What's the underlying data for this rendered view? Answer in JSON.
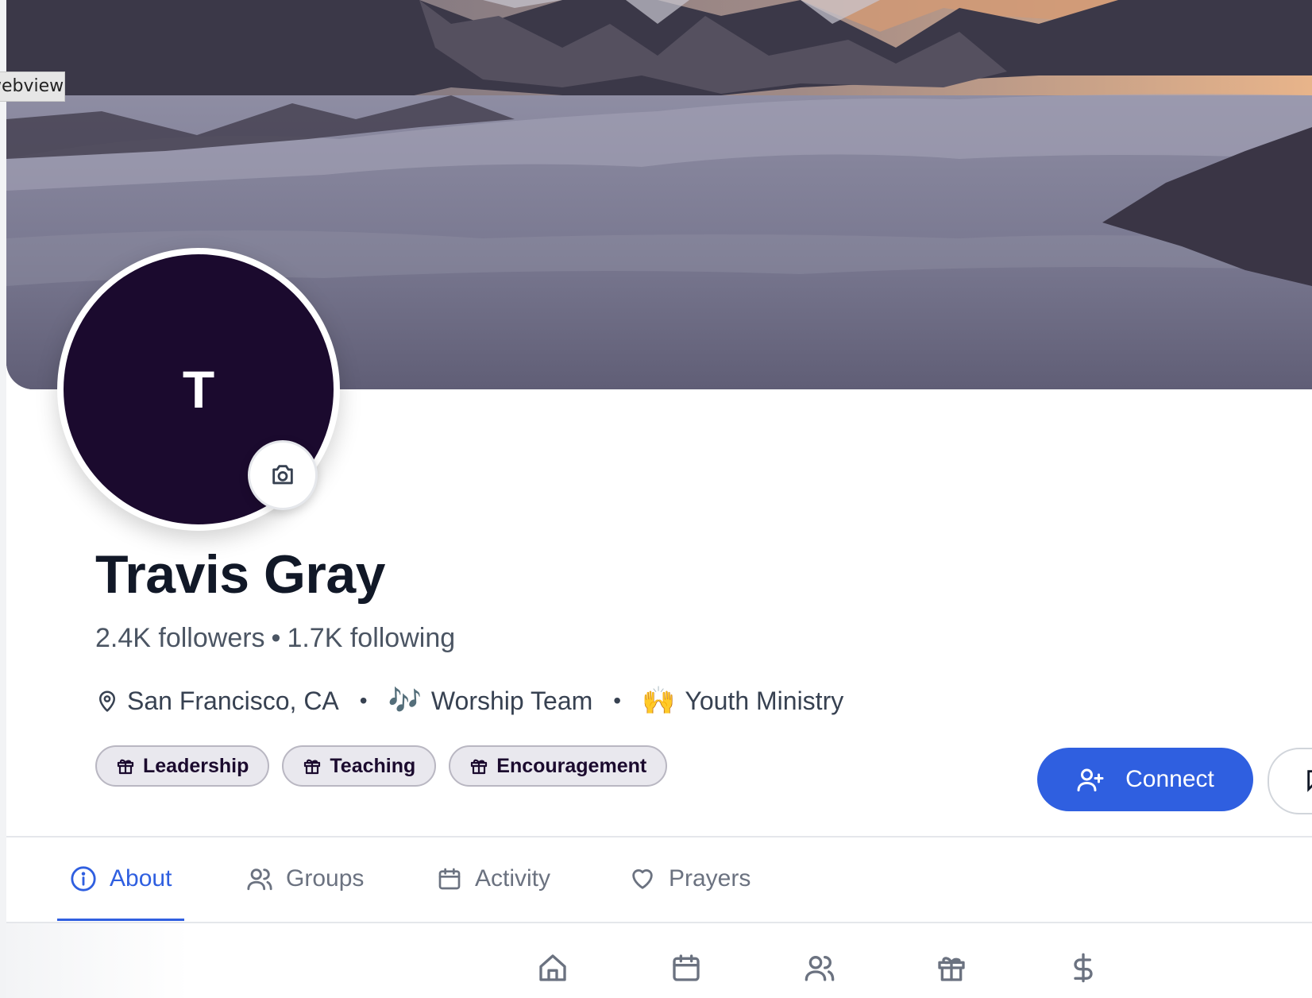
{
  "window": {
    "webview_label": "webview"
  },
  "profile": {
    "initial": "T",
    "name": "Travis Gray",
    "followers": "2.4K followers",
    "following": "1.7K following",
    "separator": "•",
    "location": "San Francisco, CA",
    "ministries": [
      {
        "emoji": "🎶",
        "label": "Worship Team"
      },
      {
        "emoji": "🙌",
        "label": "Youth Ministry"
      }
    ],
    "gifts": [
      "Leadership",
      "Teaching",
      "Encouragement"
    ]
  },
  "actions": {
    "connect_label": "Connect"
  },
  "tabs": [
    {
      "label": "About",
      "icon": "info-icon",
      "active": true
    },
    {
      "label": "Groups",
      "icon": "users-icon",
      "active": false
    },
    {
      "label": "Activity",
      "icon": "calendar-icon",
      "active": false
    },
    {
      "label": "Prayers",
      "icon": "heart-icon",
      "active": false
    }
  ],
  "bottom_nav": [
    "home-icon",
    "calendar-icon",
    "users-icon",
    "gift-icon",
    "dollar-icon"
  ],
  "colors": {
    "accent": "#2f5fe0",
    "avatar_bg": "#1b0a2e",
    "tag_bg": "#e9e8ee"
  }
}
